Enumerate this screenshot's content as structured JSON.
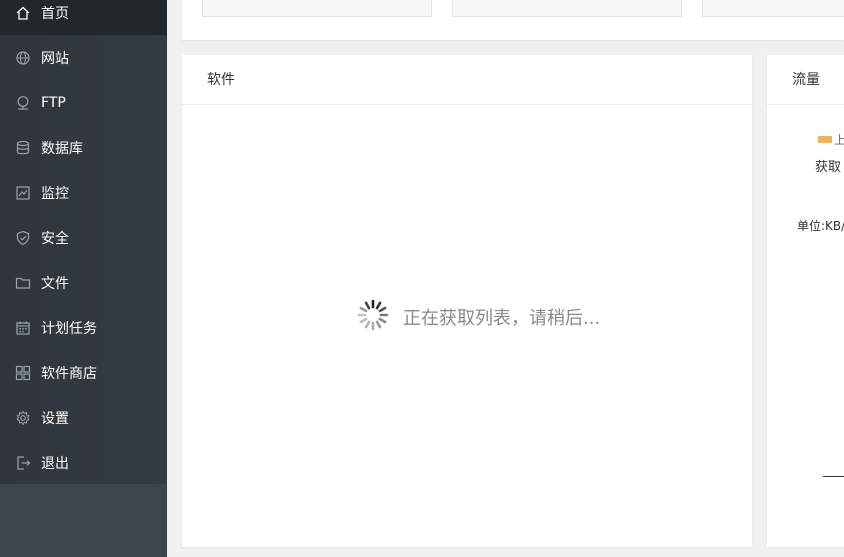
{
  "sidebar": {
    "items": [
      {
        "label": "首页",
        "icon": "home-icon",
        "active": true
      },
      {
        "label": "网站",
        "icon": "globe-icon"
      },
      {
        "label": "FTP",
        "icon": "ftp-icon"
      },
      {
        "label": "数据库",
        "icon": "database-icon"
      },
      {
        "label": "监控",
        "icon": "monitor-icon"
      },
      {
        "label": "安全",
        "icon": "shield-icon"
      },
      {
        "label": "文件",
        "icon": "folder-icon"
      },
      {
        "label": "计划任务",
        "icon": "calendar-icon"
      },
      {
        "label": "软件商店",
        "icon": "apps-grid-icon"
      },
      {
        "label": "设置",
        "icon": "gear-icon"
      },
      {
        "label": "退出",
        "icon": "logout-icon"
      }
    ]
  },
  "software_panel": {
    "title": "软件",
    "loading_text": "正在获取列表，请稍后..."
  },
  "traffic_panel": {
    "title": "流量",
    "legend_upload": "上",
    "fetching": "获取",
    "unit": "单位:KB/"
  },
  "colors": {
    "sidebar_bg": "#343b42",
    "active_bg": "#22272c",
    "upload_legend": "#f0b64b"
  }
}
